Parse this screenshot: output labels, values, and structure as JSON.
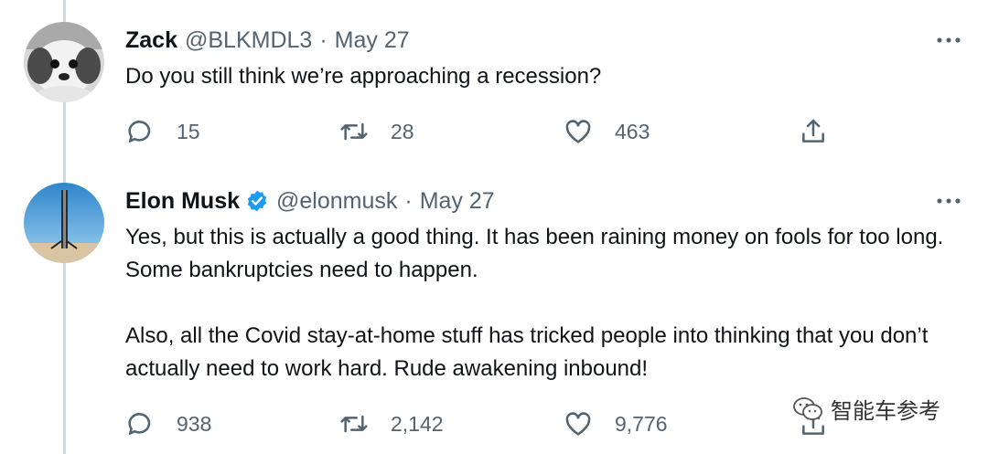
{
  "tweets": [
    {
      "name": "Zack",
      "handle": "@BLKMDL3",
      "separator": "·",
      "date": "May 27",
      "text_paragraphs": [
        "Do you still think we’re approaching a recession?"
      ],
      "replies": "15",
      "retweets": "28",
      "likes": "463"
    },
    {
      "name": "Elon Musk",
      "verified": true,
      "handle": "@elonmusk",
      "separator": "·",
      "date": "May 27",
      "text_paragraphs": [
        "Yes, but this is actually a good thing. It has been raining money on fools for too long. Some bankruptcies need to happen.",
        "Also, all the Covid stay-at-home stuff has tricked people into thinking that you don’t actually need to work hard. Rude awakening inbound!"
      ],
      "replies": "938",
      "retweets": "2,142",
      "likes": "9,776"
    }
  ],
  "icons": {
    "reply": "speech-bubble-icon",
    "retweet": "retweet-icon",
    "like": "heart-icon",
    "share": "share-icon",
    "more": "more-dots-icon",
    "verified": "verified-badge-icon"
  },
  "watermark": {
    "text": "智能车参考"
  },
  "colors": {
    "text": "#0f1419",
    "secondary": "#536471",
    "verified": "#1d9bf0",
    "thread": "#cfd9de"
  }
}
